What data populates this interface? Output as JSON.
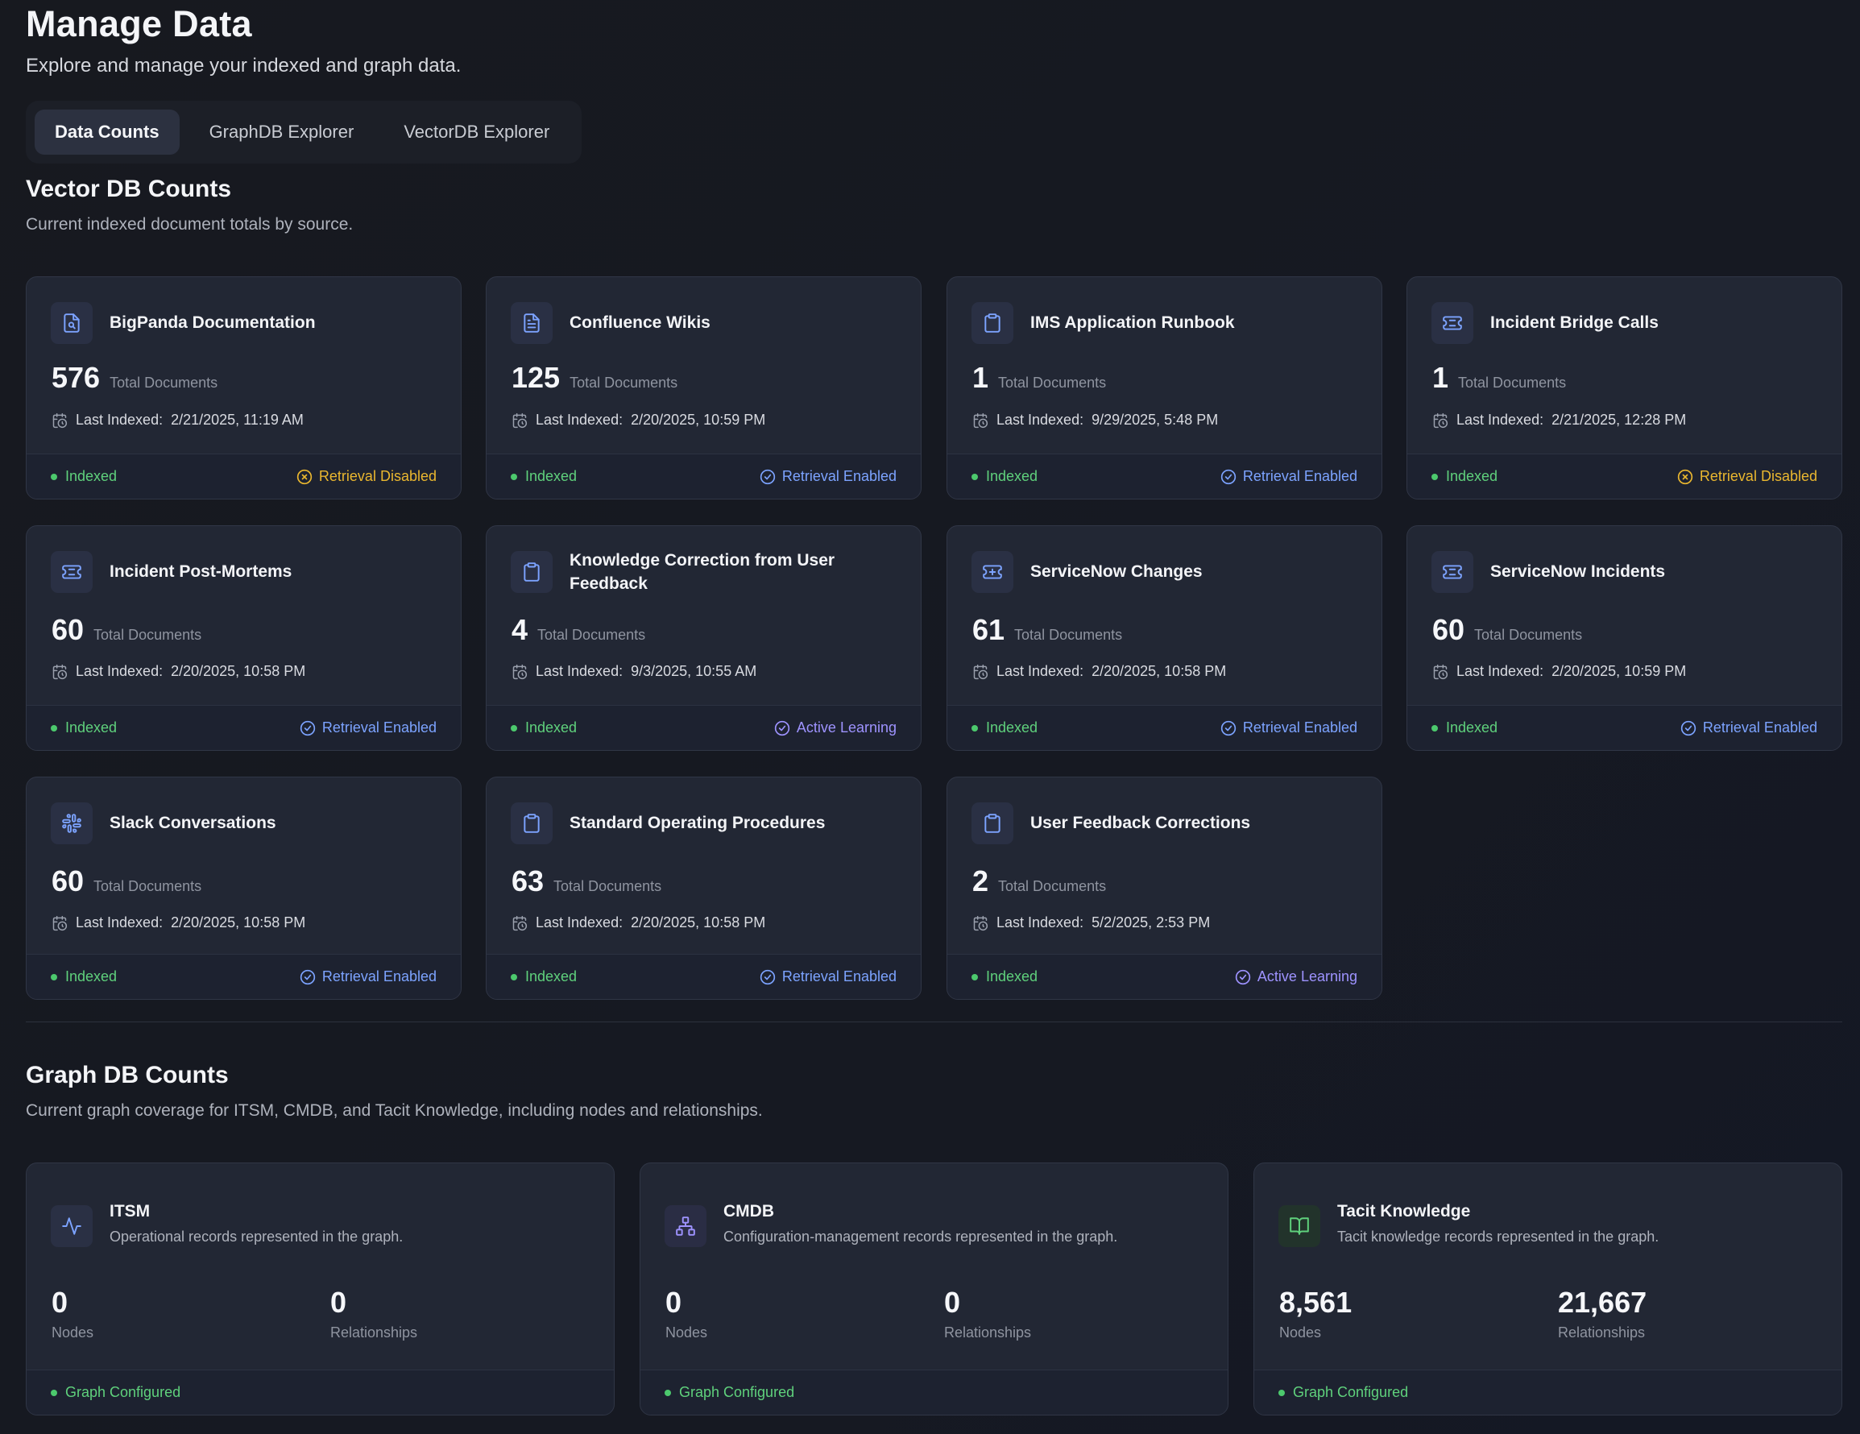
{
  "header": {
    "title": "Manage Data",
    "subtitle": "Explore and manage your indexed and graph data."
  },
  "tabs": [
    {
      "label": "Data Counts",
      "active": true
    },
    {
      "label": "GraphDB Explorer",
      "active": false
    },
    {
      "label": "VectorDB Explorer",
      "active": false
    }
  ],
  "vector": {
    "title": "Vector DB Counts",
    "description": "Current indexed document totals by source.",
    "count_label": "Total Documents",
    "last_indexed_label": "Last Indexed:",
    "status_label": "Indexed",
    "cards": [
      {
        "name": "BigPanda Documentation",
        "count": "576",
        "last_indexed": "2/21/2025, 11:19 AM",
        "badge": "Retrieval Disabled",
        "badge_type": "disabled",
        "icon": "file-search-icon"
      },
      {
        "name": "Confluence Wikis",
        "count": "125",
        "last_indexed": "2/20/2025, 10:59 PM",
        "badge": "Retrieval Enabled",
        "badge_type": "enabled",
        "icon": "file-text-icon"
      },
      {
        "name": "IMS Application Runbook",
        "count": "1",
        "last_indexed": "9/29/2025, 5:48 PM",
        "badge": "Retrieval Enabled",
        "badge_type": "enabled",
        "icon": "clipboard-icon"
      },
      {
        "name": "Incident Bridge Calls",
        "count": "1",
        "last_indexed": "2/21/2025, 12:28 PM",
        "badge": "Retrieval Disabled",
        "badge_type": "disabled",
        "icon": "ticket-icon"
      },
      {
        "name": "Incident Post-Mortems",
        "count": "60",
        "last_indexed": "2/20/2025, 10:58 PM",
        "badge": "Retrieval Enabled",
        "badge_type": "enabled",
        "icon": "ticket-icon"
      },
      {
        "name": "Knowledge Correction from User Feedback",
        "count": "4",
        "last_indexed": "9/3/2025, 10:55 AM",
        "badge": "Active Learning",
        "badge_type": "learning",
        "icon": "clipboard-icon"
      },
      {
        "name": "ServiceNow Changes",
        "count": "61",
        "last_indexed": "2/20/2025, 10:58 PM",
        "badge": "Retrieval Enabled",
        "badge_type": "enabled",
        "icon": "ticket-plus-icon"
      },
      {
        "name": "ServiceNow Incidents",
        "count": "60",
        "last_indexed": "2/20/2025, 10:59 PM",
        "badge": "Retrieval Enabled",
        "badge_type": "enabled",
        "icon": "ticket-icon"
      },
      {
        "name": "Slack Conversations",
        "count": "60",
        "last_indexed": "2/20/2025, 10:58 PM",
        "badge": "Retrieval Enabled",
        "badge_type": "enabled",
        "icon": "slack-icon"
      },
      {
        "name": "Standard Operating Procedures",
        "count": "63",
        "last_indexed": "2/20/2025, 10:58 PM",
        "badge": "Retrieval Enabled",
        "badge_type": "enabled",
        "icon": "clipboard-icon"
      },
      {
        "name": "User Feedback Corrections",
        "count": "2",
        "last_indexed": "5/2/2025, 2:53 PM",
        "badge": "Active Learning",
        "badge_type": "learning",
        "icon": "clipboard-icon"
      }
    ]
  },
  "graph": {
    "title": "Graph DB Counts",
    "description": "Current graph coverage for ITSM, CMDB, and Tacit Knowledge, including nodes and relationships.",
    "nodes_label": "Nodes",
    "relationships_label": "Relationships",
    "status_label": "Graph Configured",
    "cards": [
      {
        "name": "ITSM",
        "description": "Operational records represented in the graph.",
        "nodes": "0",
        "relationships": "0",
        "icon": "activity-icon"
      },
      {
        "name": "CMDB",
        "description": "Configuration-management records represented in the graph.",
        "nodes": "0",
        "relationships": "0",
        "icon": "network-icon"
      },
      {
        "name": "Tacit Knowledge",
        "description": "Tacit knowledge records represented in the graph.",
        "nodes": "8,561",
        "relationships": "21,667",
        "icon": "book-open-icon"
      }
    ]
  },
  "colors": {
    "accent_blue": "#7ca3ff",
    "disabled_yellow": "#eab72f",
    "learning_purple": "#9e93ff",
    "indexed_green": "#5fd17c"
  }
}
